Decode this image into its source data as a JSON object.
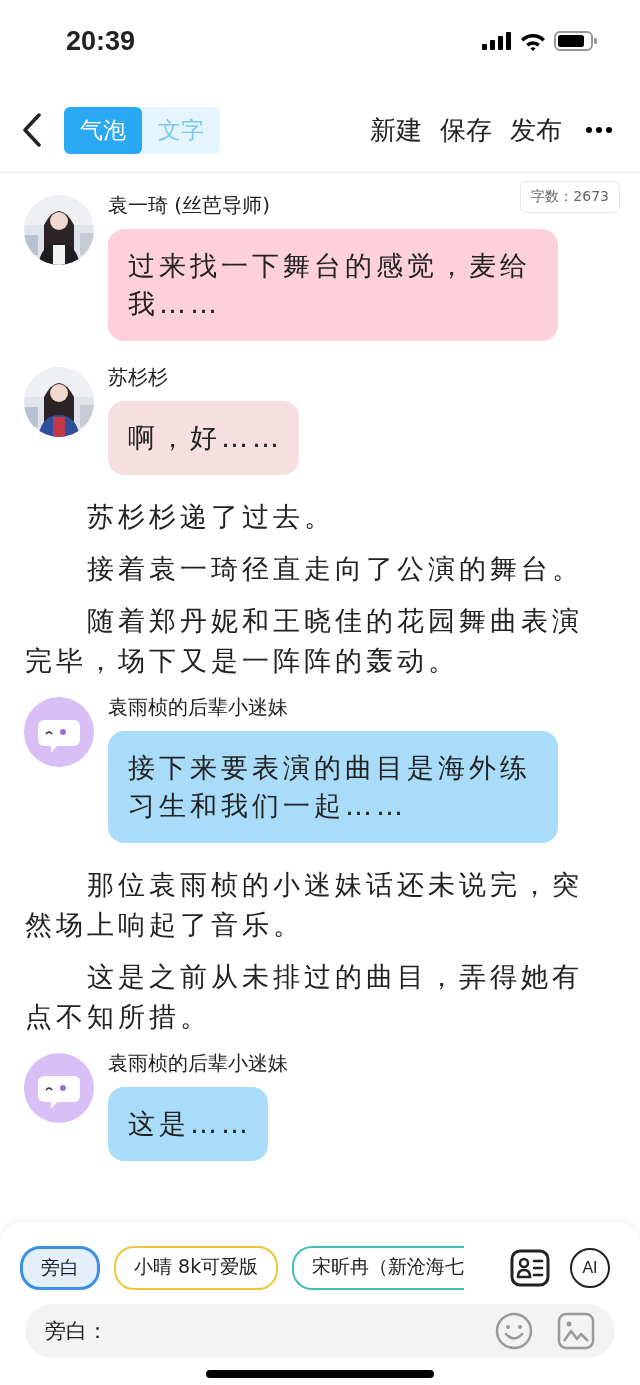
{
  "status_bar": {
    "time": "20:39"
  },
  "header": {
    "tabs": [
      {
        "label": "气泡",
        "selected": true
      },
      {
        "label": "文字",
        "selected": false
      }
    ],
    "actions": [
      "新建",
      "保存",
      "发布"
    ]
  },
  "word_count": "字数：2673",
  "messages": [
    {
      "kind": "bubble",
      "name": "袁一琦 (丝芭导师)",
      "text": "过来找一下舞台的感觉，麦给我……",
      "color": "#fdd0dc"
    },
    {
      "kind": "bubble",
      "name": "苏杉杉",
      "text": "啊，好……",
      "color": "#f6dfe1"
    },
    {
      "kind": "narration",
      "text": "苏杉杉递了过去。"
    },
    {
      "kind": "narration",
      "text": "接着袁一琦径直走向了公演的舞台。"
    },
    {
      "kind": "narration",
      "text": "随着郑丹妮和王晓佳的花园舞曲表演完毕，场下又是一阵阵的轰动。"
    },
    {
      "kind": "bubble",
      "avatar": {
        "kind": "icon"
      },
      "name": "袁雨桢的后辈小迷妹",
      "text": "接下来要表演的曲目是海外练习生和我们一起……",
      "color": "#a8dcf8"
    },
    {
      "kind": "narration",
      "text": "那位袁雨桢的小迷妹话还未说完，突然场上响起了音乐。"
    },
    {
      "kind": "narration",
      "text": "这是之前从未排过的曲目，弄得她有点不知所措。"
    },
    {
      "kind": "bubble",
      "avatar": {
        "kind": "icon"
      },
      "name": "袁雨桢的后辈小迷妹",
      "text": "这是……",
      "color": "#a8dcf8"
    }
  ],
  "roles": [
    {
      "label": "旁白",
      "selected": true,
      "color": "#3d8fe8"
    },
    {
      "label": "小晴 8k可爱版",
      "selected": false,
      "color": "#efc43a"
    },
    {
      "label": "宋昕冉（新沧海七",
      "selected": false,
      "color": "#3fc1b8"
    }
  ],
  "ai_button": "AI",
  "input": {
    "prefix": "旁白："
  }
}
